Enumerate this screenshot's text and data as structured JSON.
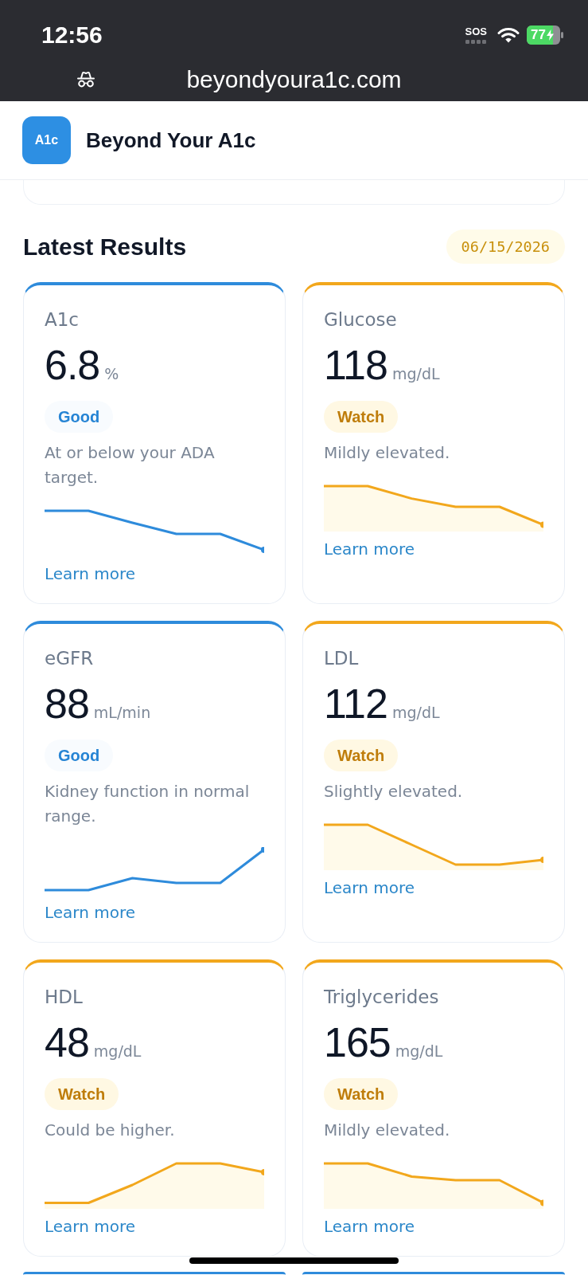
{
  "status_bar": {
    "time": "12:56",
    "carrier": "SOS",
    "battery": "77",
    "charging": true
  },
  "browser": {
    "url": "beyondyoura1c.com",
    "private": true
  },
  "header": {
    "logo": "A1c",
    "title": "Beyond Your A1c"
  },
  "section": {
    "title": "Latest Results",
    "date": "06/15/2026"
  },
  "results": [
    {
      "name": "A1c",
      "value": "6.8",
      "unit": "%",
      "kind": "good",
      "badge": "Good",
      "note": "At or below your ADA target.",
      "link": "Learn more"
    },
    {
      "name": "Glucose",
      "value": "118",
      "unit": "mg/dL",
      "kind": "watch",
      "badge": "Watch",
      "note": "Mildly elevated.",
      "link": "Learn more"
    },
    {
      "name": "eGFR",
      "value": "88",
      "unit": "mL/min",
      "kind": "good",
      "badge": "Good",
      "note": "Kidney function in normal range.",
      "link": "Learn more"
    },
    {
      "name": "LDL",
      "value": "112",
      "unit": "mg/dL",
      "kind": "watch",
      "badge": "Watch",
      "note": "Slightly elevated.",
      "link": "Learn more"
    },
    {
      "name": "HDL",
      "value": "48",
      "unit": "mg/dL",
      "kind": "watch",
      "badge": "Watch",
      "note": "Could be higher.",
      "link": "Learn more"
    },
    {
      "name": "Triglycerides",
      "value": "165",
      "unit": "mg/dL",
      "kind": "watch",
      "badge": "Watch",
      "note": "Mildly elevated.",
      "link": "Learn more"
    }
  ],
  "more_results": [
    {
      "kind": "good"
    },
    {
      "kind": "good"
    }
  ]
}
